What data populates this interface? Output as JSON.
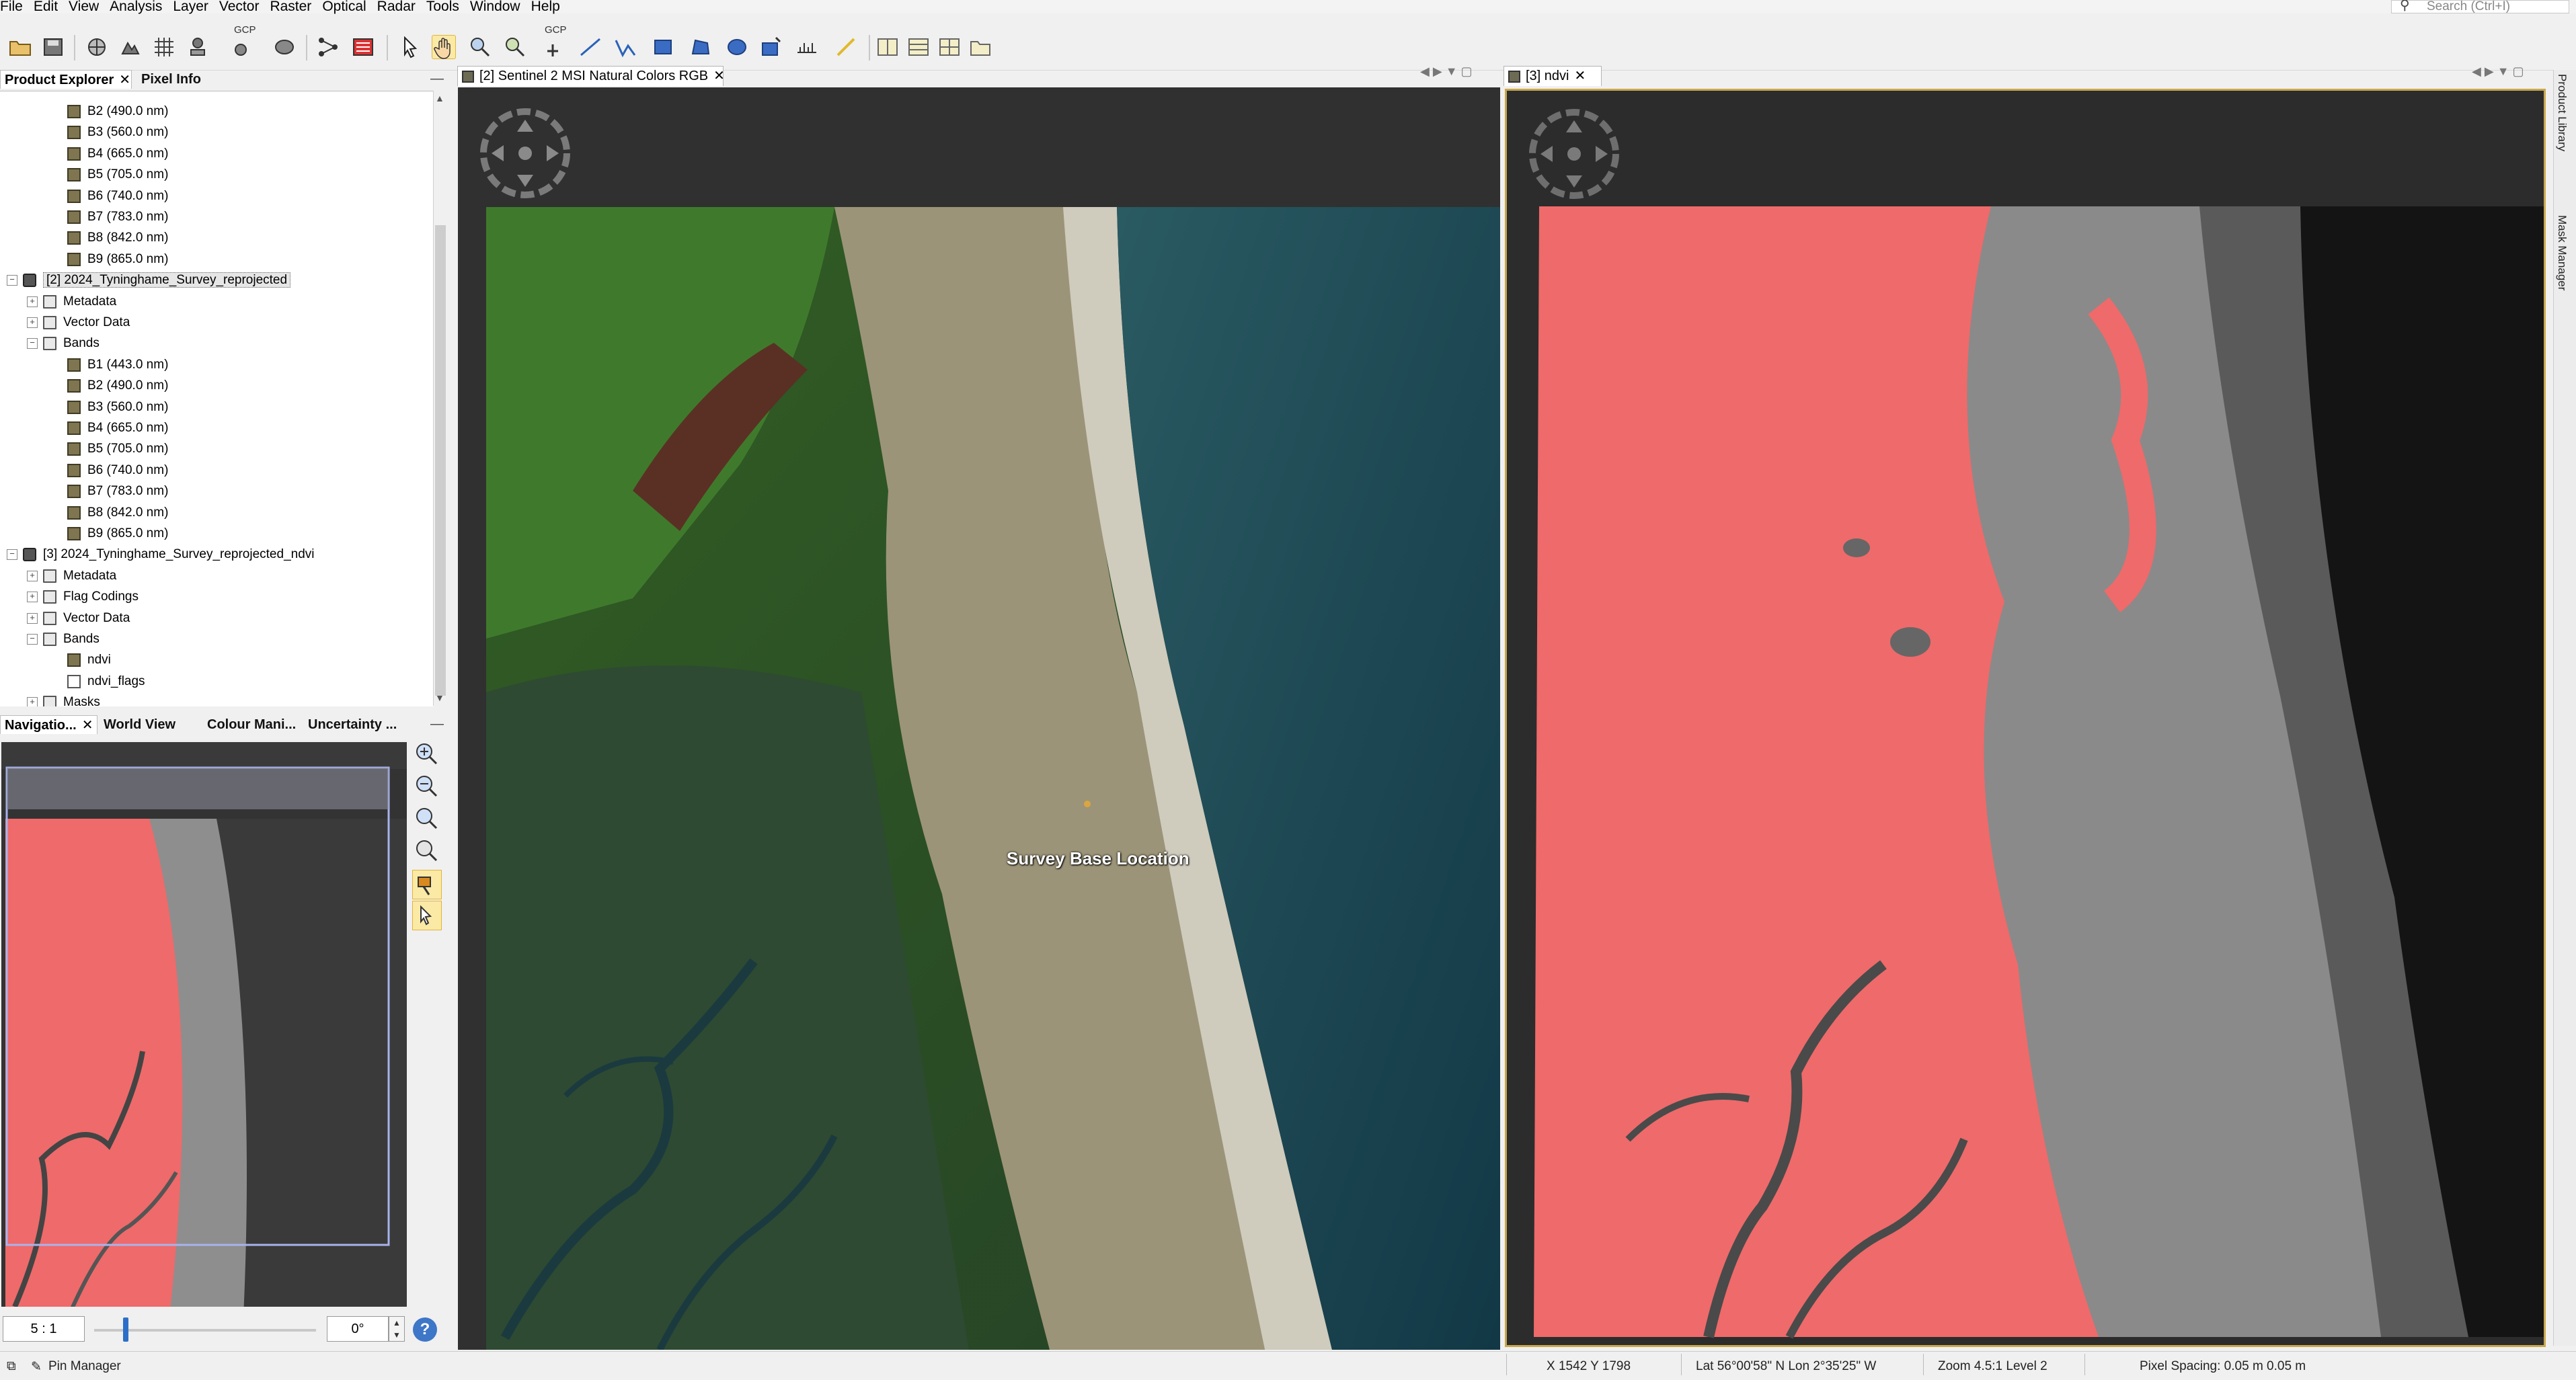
{
  "menu": [
    "File",
    "Edit",
    "View",
    "Analysis",
    "Layer",
    "Vector",
    "Raster",
    "Optical",
    "Radar",
    "Tools",
    "Window",
    "Help"
  ],
  "search": {
    "placeholder": "Search (Ctrl+I)"
  },
  "toolbar": {
    "gcp_label_1": "GCP",
    "gcp_label_2": "GCP"
  },
  "left_panel": {
    "tabs": [
      {
        "label": "Product Explorer"
      },
      {
        "label": "Pixel Info"
      }
    ],
    "tree": [
      {
        "label": "B2 (490.0 nm)",
        "kind": "band"
      },
      {
        "label": "B3 (560.0 nm)",
        "kind": "band"
      },
      {
        "label": "B4 (665.0 nm)",
        "kind": "band"
      },
      {
        "label": "B5 (705.0 nm)",
        "kind": "band"
      },
      {
        "label": "B6 (740.0 nm)",
        "kind": "band"
      },
      {
        "label": "B7 (783.0 nm)",
        "kind": "band"
      },
      {
        "label": "B8 (842.0 nm)",
        "kind": "band"
      },
      {
        "label": "B9 (865.0 nm)",
        "kind": "band"
      },
      {
        "label": "[2] 2024_Tyninghame_Survey_reprojected",
        "kind": "product"
      },
      {
        "label": "Metadata",
        "kind": "folder"
      },
      {
        "label": "Vector Data",
        "kind": "folder"
      },
      {
        "label": "Bands",
        "kind": "folder"
      },
      {
        "label": "B1 (443.0 nm)",
        "kind": "band"
      },
      {
        "label": "B2 (490.0 nm)",
        "kind": "band"
      },
      {
        "label": "B3 (560.0 nm)",
        "kind": "band"
      },
      {
        "label": "B4 (665.0 nm)",
        "kind": "band"
      },
      {
        "label": "B5 (705.0 nm)",
        "kind": "band"
      },
      {
        "label": "B6 (740.0 nm)",
        "kind": "band"
      },
      {
        "label": "B7 (783.0 nm)",
        "kind": "band"
      },
      {
        "label": "B8 (842.0 nm)",
        "kind": "band"
      },
      {
        "label": "B9 (865.0 nm)",
        "kind": "band"
      },
      {
        "label": "[3] 2024_Tyninghame_Survey_reprojected_ndvi",
        "kind": "product"
      },
      {
        "label": "Metadata",
        "kind": "folder"
      },
      {
        "label": "Flag Codings",
        "kind": "folder"
      },
      {
        "label": "Vector Data",
        "kind": "folder"
      },
      {
        "label": "Bands",
        "kind": "folder"
      },
      {
        "label": "ndvi",
        "kind": "band"
      },
      {
        "label": "ndvi_flags",
        "kind": "flag"
      },
      {
        "label": "Masks",
        "kind": "folder"
      }
    ]
  },
  "nav_panel": {
    "tabs": [
      {
        "label": "Navigatio..."
      },
      {
        "label": "World View"
      },
      {
        "label": "Colour Mani..."
      },
      {
        "label": "Uncertainty ..."
      }
    ],
    "zoom": "5 : 1",
    "rotation": "0°"
  },
  "view1": {
    "title": "[2] Sentinel 2 MSI Natural Colors RGB",
    "pin_label": "Survey Base Location"
  },
  "view2": {
    "title": "[3] ndvi"
  },
  "side_tabs": [
    "Product Library",
    "Mask Manager"
  ],
  "statusbar": {
    "pin_manager": "Pin Manager",
    "xy": "X   1542  Y   1798",
    "latlon": "Lat 56°00'58\" N  Lon 2°35'25\" W",
    "zoom": "Zoom 4.5:1  Level 2",
    "spacing": "Pixel Spacing: 0.05 m  0.05 m"
  },
  "colors": {
    "ndvi_red": "#ef6a6a",
    "water": "#1e4a5a",
    "veg": "#2f5a2a"
  }
}
